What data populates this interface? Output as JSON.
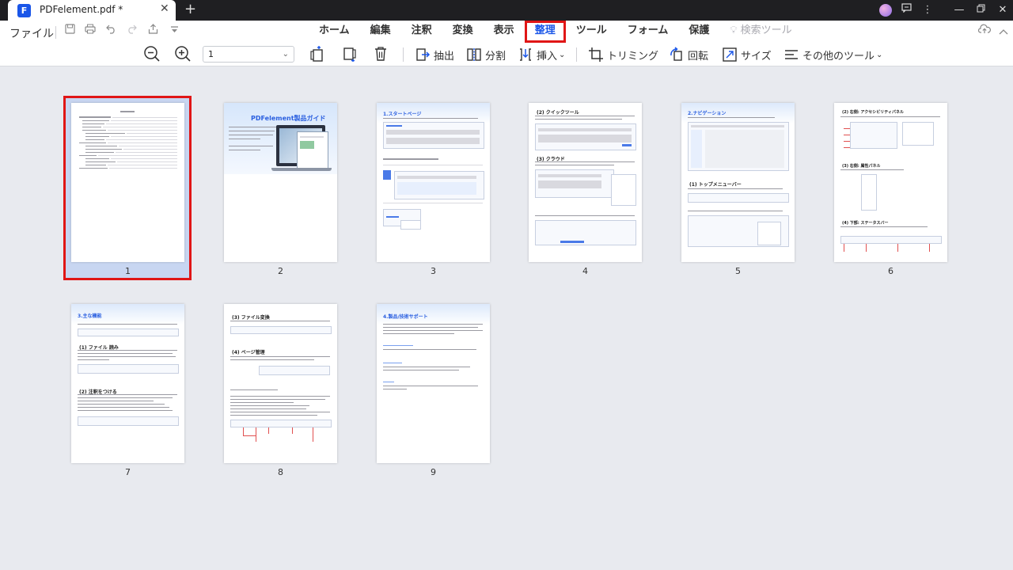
{
  "window": {
    "tab_title": "PDFelement.pdf *",
    "tab_close": "✕",
    "new_tab": "+",
    "app_logo_icon": "pdfelement-logo-icon",
    "window_controls": [
      "minimize",
      "maximize",
      "close"
    ]
  },
  "menubar": {
    "file_label": "ファイル",
    "tabs": [
      {
        "label": "ホーム",
        "active": false
      },
      {
        "label": "編集",
        "active": false
      },
      {
        "label": "注釈",
        "active": false
      },
      {
        "label": "変換",
        "active": false
      },
      {
        "label": "表示",
        "active": false
      },
      {
        "label": "整理",
        "active": true
      },
      {
        "label": "ツール",
        "active": false
      },
      {
        "label": "フォーム",
        "active": false
      },
      {
        "label": "保護",
        "active": false
      },
      {
        "label": "検索ツール",
        "active": false,
        "disabled": true
      }
    ]
  },
  "toolbar": {
    "page_select_value": "1",
    "extract_label": "抽出",
    "split_label": "分割",
    "insert_label": "挿入",
    "trim_label": "トリミング",
    "rotate_label": "回転",
    "size_label": "サイズ",
    "more_label": "その他のツール"
  },
  "pages": [
    {
      "number": "1",
      "selected": true
    },
    {
      "number": "2",
      "selected": false,
      "title": "PDFelement製品ガイド"
    },
    {
      "number": "3",
      "selected": false,
      "title": "1.スタートページ"
    },
    {
      "number": "4",
      "selected": false,
      "title": "(2) クイックツール"
    },
    {
      "number": "5",
      "selected": false,
      "title": "2.ナビゲーション"
    },
    {
      "number": "6",
      "selected": false,
      "title": "(2) 右側: アクセシビリティパネル"
    },
    {
      "number": "7",
      "selected": false,
      "title": "3.主な機能"
    },
    {
      "number": "8",
      "selected": false,
      "title": "(3) ファイル変換"
    },
    {
      "number": "9",
      "selected": false,
      "title": "4.製品/技術サポート"
    }
  ],
  "colors": {
    "accent": "#1a56e8",
    "highlight": "#e01616",
    "selection_fill": "#c8d6f1",
    "workspace_bg": "#e8eaef"
  }
}
